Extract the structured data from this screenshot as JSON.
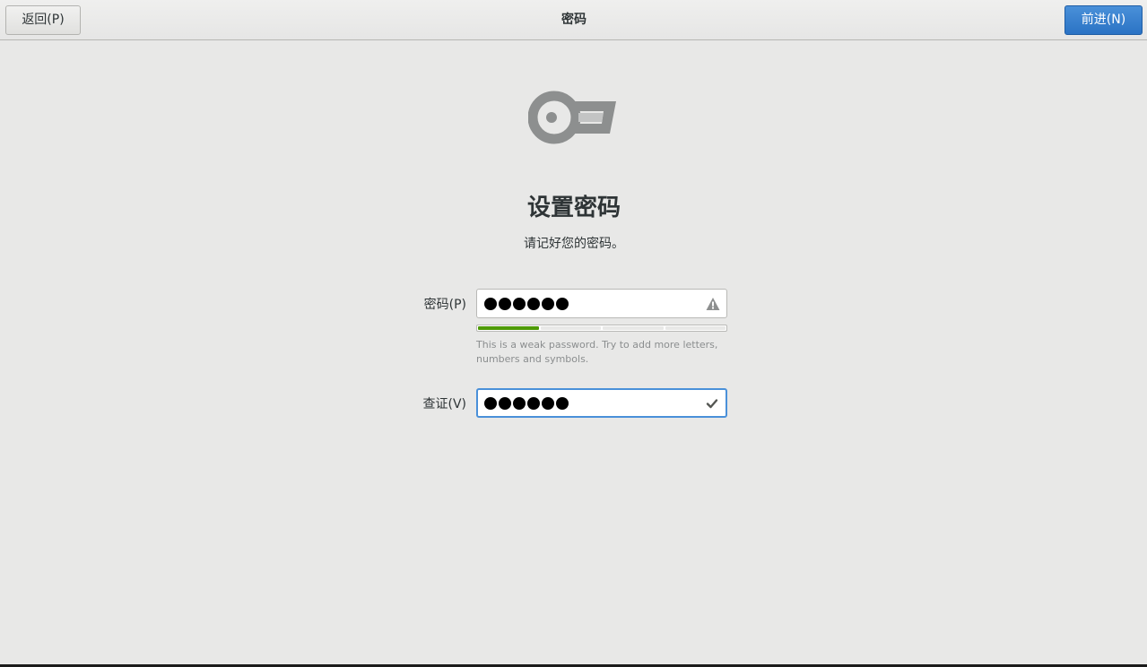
{
  "header": {
    "back_label": "返回(P)",
    "title": "密码",
    "next_label": "前进(N)"
  },
  "main": {
    "icon": "key-icon",
    "title": "设置密码",
    "subtitle": "请记好您的密码。"
  },
  "form": {
    "password": {
      "label": "密码(P)",
      "masked_length": 6,
      "status_icon": "warning-icon"
    },
    "strength": {
      "level_fraction": 0.25,
      "hint": "This is a weak password. Try to add more letters, numbers and symbols."
    },
    "verify": {
      "label": "查证(V)",
      "masked_length": 6,
      "status_icon": "checkmark-icon"
    }
  },
  "colors": {
    "accent": "#4a90d9",
    "strength_weak": "#4e9a06",
    "background": "#e8e8e7"
  }
}
